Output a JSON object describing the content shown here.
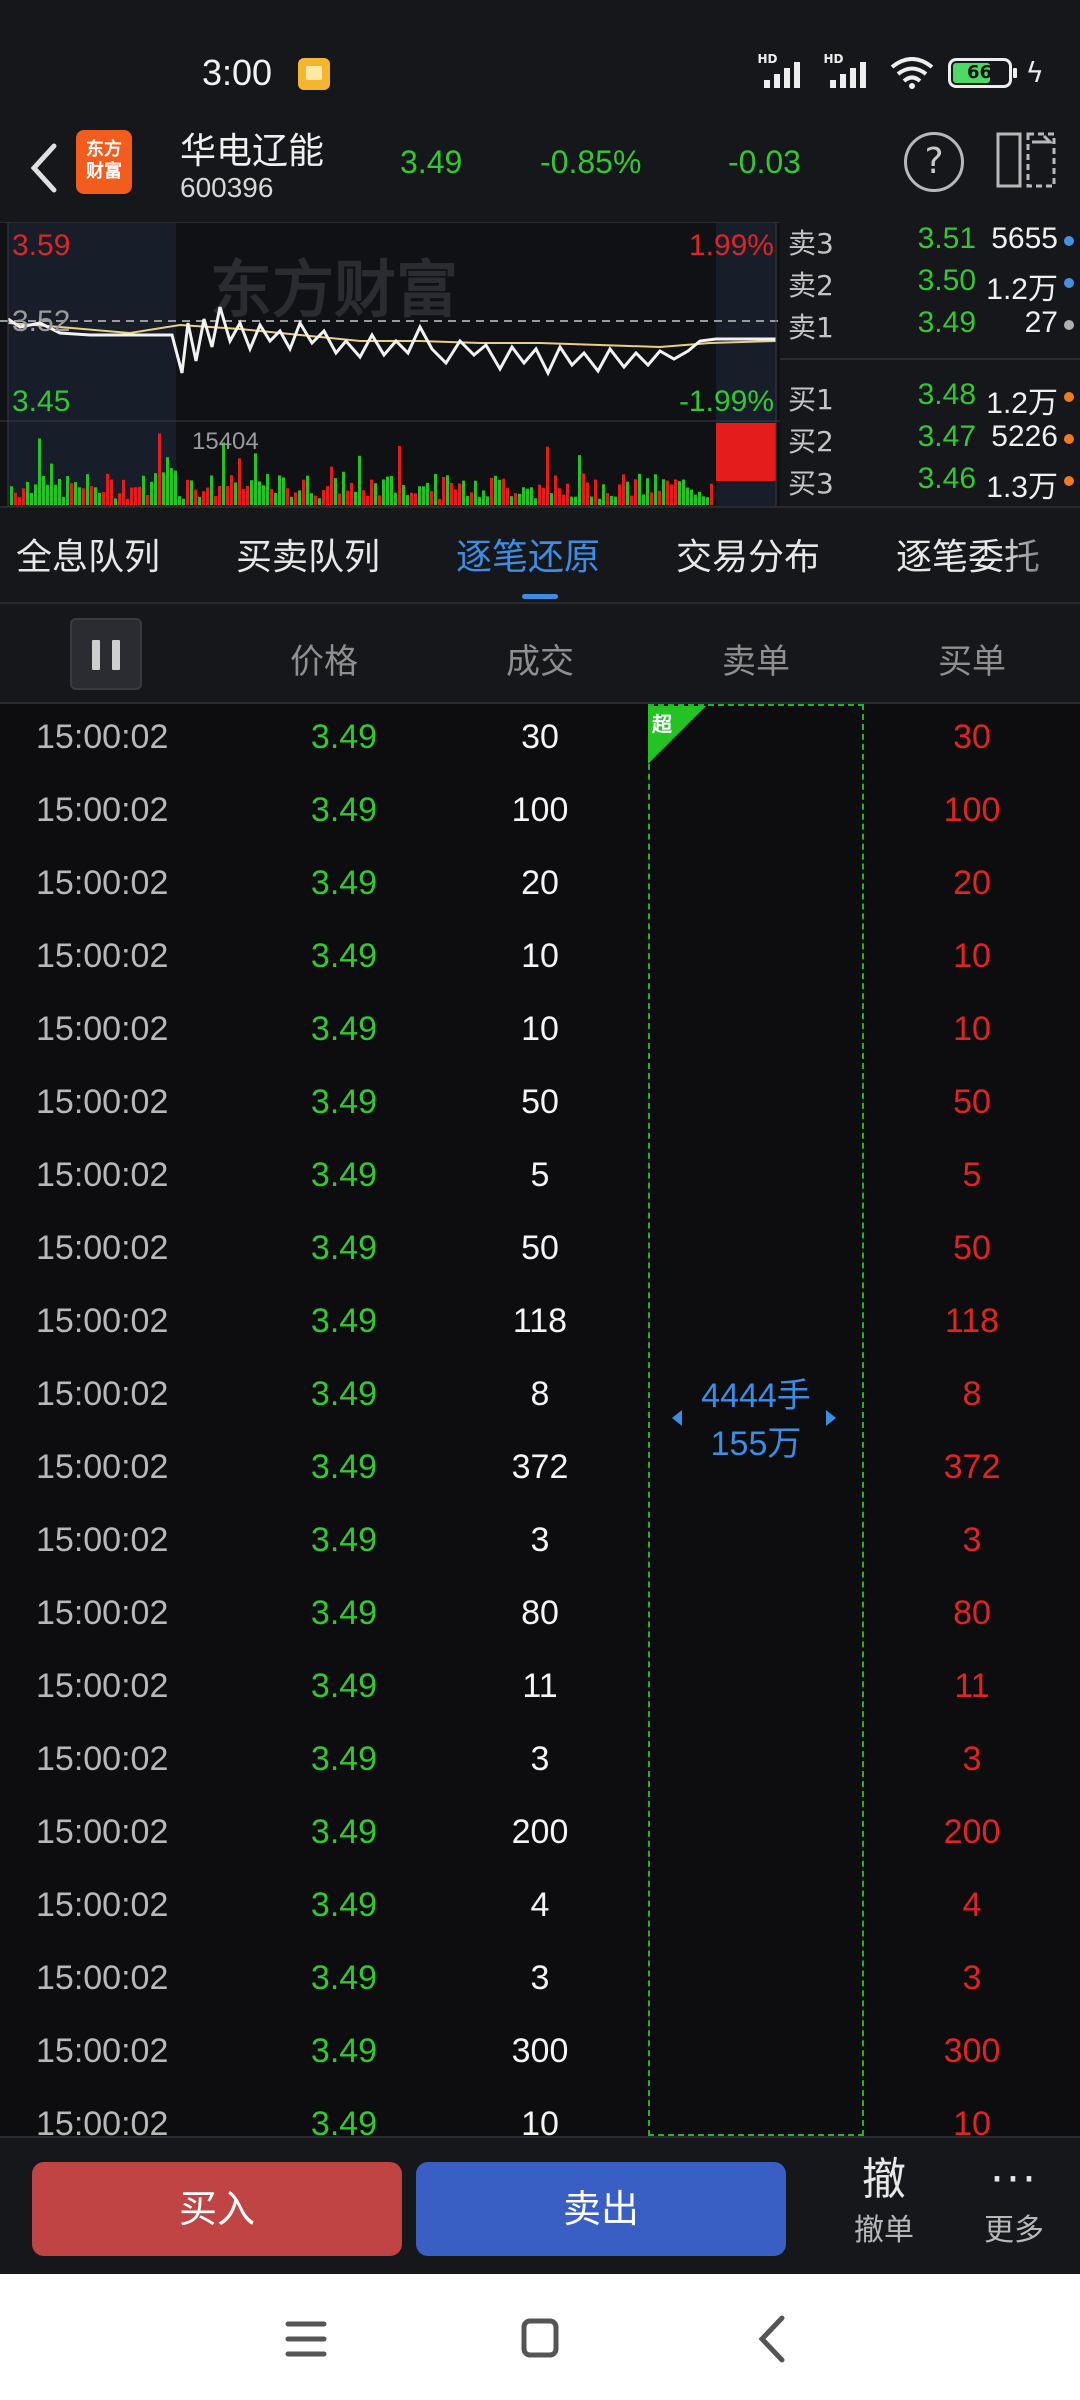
{
  "status_bar": {
    "time": "3:00",
    "battery": "66",
    "hd1": "HD",
    "hd2": "HD"
  },
  "header": {
    "logo_line1": "东方",
    "logo_line2": "财富",
    "stock_name": "华电辽能",
    "stock_code": "600396",
    "price": "3.49",
    "change_pct": "-0.85%",
    "change": "-0.03",
    "help": "?"
  },
  "chart": {
    "price_high": "3.59",
    "price_prev": "3.52",
    "price_low": "3.45",
    "pct_high": "1.99%",
    "pct_low": "-1.99%",
    "volume_max": "15404",
    "watermark": "东方财富"
  },
  "quote": {
    "asks": [
      {
        "label": "卖3",
        "price": "3.51",
        "vol": "5655",
        "dot": "#4a90e2"
      },
      {
        "label": "卖2",
        "price": "3.50",
        "vol": "1.2万",
        "dot": "#4a90e2"
      },
      {
        "label": "卖1",
        "price": "3.49",
        "vol": "27",
        "dot": "#b0b0b0"
      }
    ],
    "bids": [
      {
        "label": "买1",
        "price": "3.48",
        "vol": "1.2万",
        "dot": "#f07a1e"
      },
      {
        "label": "买2",
        "price": "3.47",
        "vol": "5226",
        "dot": "#f07a1e"
      },
      {
        "label": "买3",
        "price": "3.46",
        "vol": "1.3万",
        "dot": "#f07a1e"
      }
    ]
  },
  "tabs": [
    "全息队列",
    "买卖队列",
    "逐笔还原",
    "交易分布",
    "逐笔委托"
  ],
  "active_tab": 2,
  "table": {
    "headers": {
      "price": "价格",
      "volume": "成交",
      "sell": "卖单",
      "buy": "买单"
    },
    "rows": [
      {
        "time": "15:00:02",
        "price": "3.49",
        "volume": "30",
        "buy": "30"
      },
      {
        "time": "15:00:02",
        "price": "3.49",
        "volume": "100",
        "buy": "100"
      },
      {
        "time": "15:00:02",
        "price": "3.49",
        "volume": "20",
        "buy": "20"
      },
      {
        "time": "15:00:02",
        "price": "3.49",
        "volume": "10",
        "buy": "10"
      },
      {
        "time": "15:00:02",
        "price": "3.49",
        "volume": "10",
        "buy": "10"
      },
      {
        "time": "15:00:02",
        "price": "3.49",
        "volume": "50",
        "buy": "50"
      },
      {
        "time": "15:00:02",
        "price": "3.49",
        "volume": "5",
        "buy": "5"
      },
      {
        "time": "15:00:02",
        "price": "3.49",
        "volume": "50",
        "buy": "50"
      },
      {
        "time": "15:00:02",
        "price": "3.49",
        "volume": "118",
        "buy": "118"
      },
      {
        "time": "15:00:02",
        "price": "3.49",
        "volume": "8",
        "buy": "8"
      },
      {
        "time": "15:00:02",
        "price": "3.49",
        "volume": "372",
        "buy": "372"
      },
      {
        "time": "15:00:02",
        "price": "3.49",
        "volume": "3",
        "buy": "3"
      },
      {
        "time": "15:00:02",
        "price": "3.49",
        "volume": "80",
        "buy": "80"
      },
      {
        "time": "15:00:02",
        "price": "3.49",
        "volume": "11",
        "buy": "11"
      },
      {
        "time": "15:00:02",
        "price": "3.49",
        "volume": "3",
        "buy": "3"
      },
      {
        "time": "15:00:02",
        "price": "3.49",
        "volume": "200",
        "buy": "200"
      },
      {
        "time": "15:00:02",
        "price": "3.49",
        "volume": "4",
        "buy": "4"
      },
      {
        "time": "15:00:02",
        "price": "3.49",
        "volume": "3",
        "buy": "3"
      },
      {
        "time": "15:00:02",
        "price": "3.49",
        "volume": "300",
        "buy": "300"
      },
      {
        "time": "15:00:02",
        "price": "3.49",
        "volume": "10",
        "buy": "10"
      }
    ],
    "sell_block": {
      "tag": "超",
      "lots": "4444手",
      "amount": "155万"
    }
  },
  "actions": {
    "buy": "买入",
    "sell": "卖出",
    "cancel_glyph": "撤",
    "cancel": "撤单",
    "more_glyph": "···",
    "more": "更多"
  },
  "colors": {
    "up": "#e02424",
    "down": "#32c832",
    "accent": "#3a8ee6",
    "bg": "#16171b"
  }
}
